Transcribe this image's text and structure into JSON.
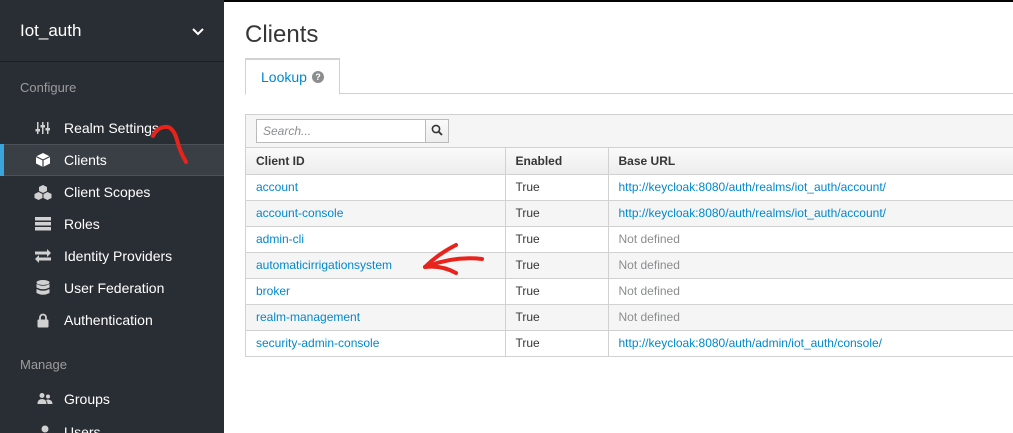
{
  "sidebar": {
    "realm_name": "Iot_auth",
    "configure_title": "Configure",
    "manage_title": "Manage",
    "configure_items": [
      {
        "label": "Realm Settings",
        "icon": "sliders-icon"
      },
      {
        "label": "Clients",
        "icon": "cube-icon",
        "active": true
      },
      {
        "label": "Client Scopes",
        "icon": "cubes-icon"
      },
      {
        "label": "Roles",
        "icon": "list-icon"
      },
      {
        "label": "Identity Providers",
        "icon": "exchange-icon"
      },
      {
        "label": "User Federation",
        "icon": "database-icon"
      },
      {
        "label": "Authentication",
        "icon": "lock-icon"
      }
    ],
    "manage_items": [
      {
        "label": "Groups",
        "icon": "users-icon"
      },
      {
        "label": "Users",
        "icon": "user-icon"
      }
    ]
  },
  "main": {
    "title": "Clients",
    "tabs": [
      {
        "label": "Lookup"
      }
    ],
    "search": {
      "placeholder": "Search..."
    },
    "columns": [
      "Client ID",
      "Enabled",
      "Base URL"
    ],
    "rows": [
      {
        "client_id": "account",
        "enabled": "True",
        "base_url": "http://keycloak:8080/auth/realms/iot_auth/account/",
        "defined": true
      },
      {
        "client_id": "account-console",
        "enabled": "True",
        "base_url": "http://keycloak:8080/auth/realms/iot_auth/account/",
        "defined": true
      },
      {
        "client_id": "admin-cli",
        "enabled": "True",
        "base_url": "Not defined",
        "defined": false
      },
      {
        "client_id": "automaticirrigationsystem",
        "enabled": "True",
        "base_url": "Not defined",
        "defined": false
      },
      {
        "client_id": "broker",
        "enabled": "True",
        "base_url": "Not defined",
        "defined": false
      },
      {
        "client_id": "realm-management",
        "enabled": "True",
        "base_url": "Not defined",
        "defined": false
      },
      {
        "client_id": "security-admin-console",
        "enabled": "True",
        "base_url": "http://keycloak:8080/auth/admin/iot_auth/console/",
        "defined": true
      }
    ]
  },
  "colors": {
    "sidebar_bg": "#292e34",
    "active_accent": "#39a5dc",
    "link": "#0088ce",
    "annotation_red": "#e8231c"
  }
}
